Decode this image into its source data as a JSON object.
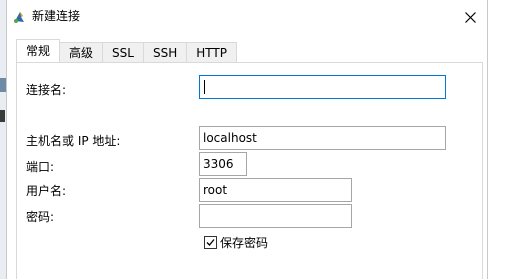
{
  "window": {
    "title": "新建连接",
    "close_glyph": "✕"
  },
  "tabs": [
    {
      "label": "常规",
      "active": true
    },
    {
      "label": "高级",
      "active": false
    },
    {
      "label": "SSL",
      "active": false
    },
    {
      "label": "SSH",
      "active": false
    },
    {
      "label": "HTTP",
      "active": false
    }
  ],
  "form": {
    "connection_name": {
      "label": "连接名:",
      "value": ""
    },
    "host": {
      "label": "主机名或 IP 地址:",
      "value": "localhost"
    },
    "port": {
      "label": "端口:",
      "value": "3306"
    },
    "username": {
      "label": "用户名:",
      "value": "root"
    },
    "password": {
      "label": "密码:",
      "value": ""
    },
    "save_password": {
      "label": "保存密码",
      "checked": true
    }
  },
  "colors": {
    "focus_border": "#0078d7",
    "input_border": "#a6a6a6",
    "tab_border": "#d9d9d9"
  },
  "icons": {
    "app": "dolphin-connection-icon",
    "close": "close-icon",
    "checkbox": "checkmark-icon"
  }
}
